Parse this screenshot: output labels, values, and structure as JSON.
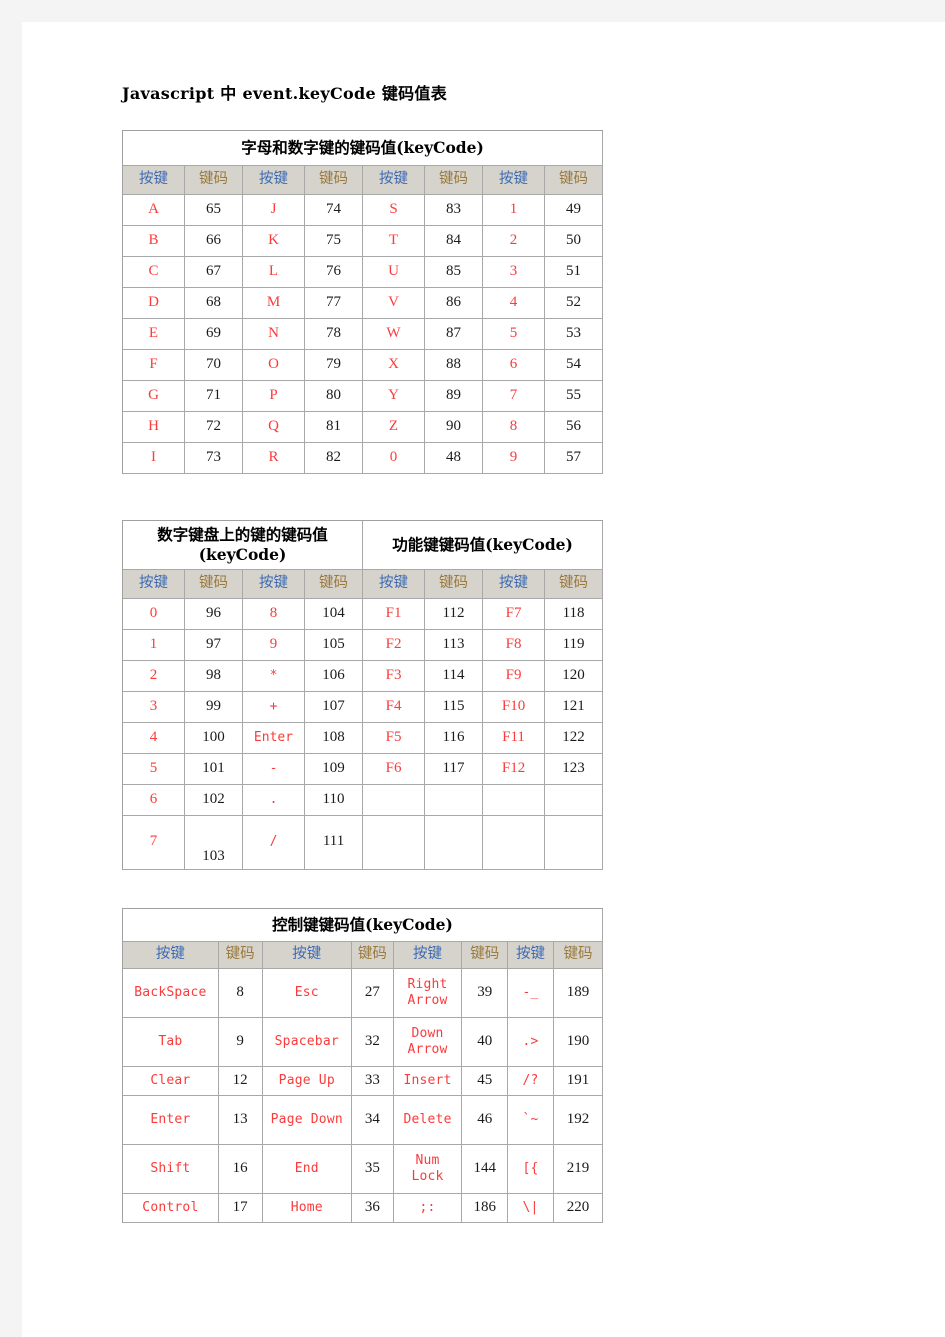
{
  "document": {
    "title": "Javascript 中 event.keyCode 键码值表",
    "header_key_label": "按键",
    "header_code_label": "键码",
    "colors": {
      "key_red": "#fb3b3b",
      "header_key_blue": "#3d6bb3",
      "header_code_tan": "#9a7a3c",
      "header_bg": "#d6d3cd",
      "border": "#a8a8a8",
      "page_bg": "#ffffff",
      "canvas_bg": "#f4f4f4"
    }
  },
  "table_alpha_numeric": {
    "title": "字母和数字键的键码值(keyCode)",
    "headers": [
      "按键",
      "键码",
      "按键",
      "键码",
      "按键",
      "键码",
      "按键",
      "键码"
    ],
    "rows": [
      [
        "A",
        "65",
        "J",
        "74",
        "S",
        "83",
        "1",
        "49"
      ],
      [
        "B",
        "66",
        "K",
        "75",
        "T",
        "84",
        "2",
        "50"
      ],
      [
        "C",
        "67",
        "L",
        "76",
        "U",
        "85",
        "3",
        "51"
      ],
      [
        "D",
        "68",
        "M",
        "77",
        "V",
        "86",
        "4",
        "52"
      ],
      [
        "E",
        "69",
        "N",
        "78",
        "W",
        "87",
        "5",
        "53"
      ],
      [
        "F",
        "70",
        "O",
        "79",
        "X",
        "88",
        "6",
        "54"
      ],
      [
        "G",
        "71",
        "P",
        "80",
        "Y",
        "89",
        "7",
        "55"
      ],
      [
        "H",
        "72",
        "Q",
        "81",
        "Z",
        "90",
        "8",
        "56"
      ],
      [
        "I",
        "73",
        "R",
        "82",
        "0",
        "48",
        "9",
        "57"
      ]
    ]
  },
  "table_numpad_function": {
    "title_left": "数字键盘上的键的键码值(keyCode)",
    "title_right": "功能键键码值(keyCode)",
    "headers": [
      "按键",
      "键码",
      "按键",
      "键码",
      "按键",
      "键码",
      "按键",
      "键码"
    ],
    "rows": [
      [
        "0",
        "96",
        "8",
        "104",
        "F1",
        "112",
        "F7",
        "118"
      ],
      [
        "1",
        "97",
        "9",
        "105",
        "F2",
        "113",
        "F8",
        "119"
      ],
      [
        "2",
        "98",
        "*",
        "106",
        "F3",
        "114",
        "F9",
        "120"
      ],
      [
        "3",
        "99",
        "+",
        "107",
        "F4",
        "115",
        "F10",
        "121"
      ],
      [
        "4",
        "100",
        "Enter",
        "108",
        "F5",
        "116",
        "F11",
        "122"
      ],
      [
        "5",
        "101",
        "-",
        "109",
        "F6",
        "117",
        "F12",
        "123"
      ],
      [
        "6",
        "102",
        ".",
        "110",
        "",
        "",
        "",
        ""
      ],
      [
        "7",
        "103",
        "/",
        "111",
        "",
        "",
        "",
        ""
      ]
    ]
  },
  "table_control": {
    "title": "控制键键码值(keyCode)",
    "headers": [
      "按键",
      "键码",
      "按键",
      "键码",
      "按键",
      "键码",
      "按键",
      "键码"
    ],
    "rows": [
      [
        "BackSpace",
        "8",
        "Esc",
        "27",
        "Right Arrow",
        "39",
        "-_",
        "189"
      ],
      [
        "Tab",
        "9",
        "Spacebar",
        "32",
        "Down Arrow",
        "40",
        ".>",
        "190"
      ],
      [
        "Clear",
        "12",
        "Page Up",
        "33",
        "Insert",
        "45",
        "/?",
        "191"
      ],
      [
        "Enter",
        "13",
        "Page Down",
        "34",
        "Delete",
        "46",
        "`~",
        "192"
      ],
      [
        "Shift",
        "16",
        "End",
        "35",
        "Num Lock",
        "144",
        "[{",
        "219"
      ],
      [
        "Control",
        "17",
        "Home",
        "36",
        ";:",
        "186",
        "\\|",
        "220"
      ]
    ]
  }
}
